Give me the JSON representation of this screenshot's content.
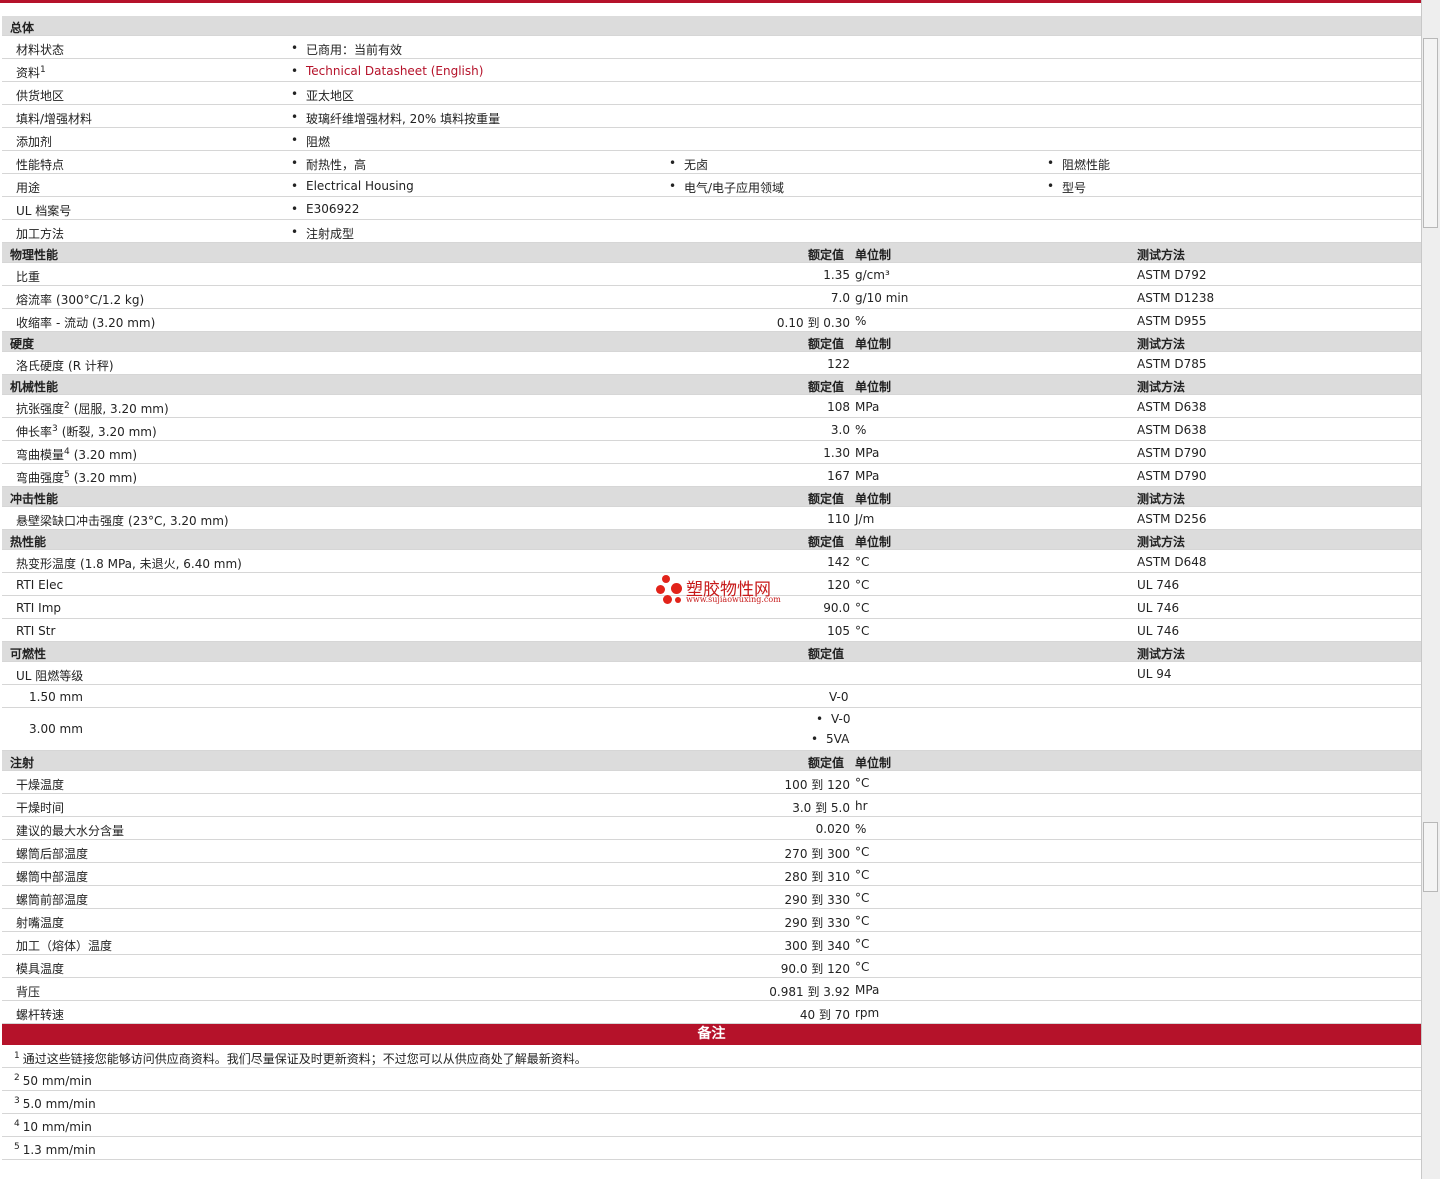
{
  "general": {
    "title": "总体",
    "rows": [
      {
        "label": "材料状态",
        "sup": "",
        "values": [
          "已商用：当前有效"
        ]
      },
      {
        "label": "资料",
        "sup": "1",
        "values": [
          "Technical Datasheet (English)"
        ],
        "link": true
      },
      {
        "label": "供货地区",
        "sup": "",
        "values": [
          "亚太地区"
        ]
      },
      {
        "label": "填料/增强材料",
        "sup": "",
        "values": [
          "玻璃纤维增强材料, 20% 填料按重量"
        ]
      },
      {
        "label": "添加剂",
        "sup": "",
        "values": [
          "阻燃"
        ]
      },
      {
        "label": "性能特点",
        "sup": "",
        "values": [
          "耐热性，高",
          "无卤",
          "阻燃性能"
        ]
      },
      {
        "label": "用途",
        "sup": "",
        "values": [
          "Electrical Housing",
          "电气/电子应用领域",
          "型号"
        ]
      },
      {
        "label": "UL 档案号",
        "sup": "",
        "values": [
          "E306922"
        ]
      },
      {
        "label": "加工方法",
        "sup": "",
        "values": [
          "注射成型"
        ]
      }
    ]
  },
  "headers": {
    "value": "额定值",
    "unit": "单位制",
    "test": "测试方法"
  },
  "sections": [
    {
      "title": "物理性能",
      "unit": true,
      "test": true,
      "rows": [
        {
          "label": "比重",
          "sup": "",
          "extra": "",
          "value": "1.35",
          "unit": "g/cm³",
          "test": "ASTM D792"
        },
        {
          "label": "熔流率",
          "sup": "",
          "extra": "(300°C/1.2 kg)",
          "value": "7.0",
          "unit": "g/10 min",
          "test": "ASTM D1238"
        },
        {
          "label": "收缩率",
          "sup": "",
          "extra": "- 流动 (3.20 mm)",
          "value": "0.10 到  0.30",
          "unit": "%",
          "test": "ASTM D955"
        }
      ]
    },
    {
      "title": "硬度",
      "unit": true,
      "test": true,
      "rows": [
        {
          "label": "洛氏硬度",
          "sup": "",
          "extra": "(R 计秤)",
          "value": "122",
          "unit": "",
          "test": "ASTM D785"
        }
      ]
    },
    {
      "title": "机械性能",
      "unit": true,
      "test": true,
      "rows": [
        {
          "label": "抗张强度",
          "sup": "2",
          "extra": "(屈服, 3.20 mm)",
          "value": "108",
          "unit": "MPa",
          "test": "ASTM D638"
        },
        {
          "label": "伸长率",
          "sup": "3",
          "extra": "(断裂, 3.20 mm)",
          "value": "3.0",
          "unit": "%",
          "test": "ASTM D638"
        },
        {
          "label": "弯曲模量",
          "sup": "4",
          "extra": "(3.20 mm)",
          "value": "1.30",
          "unit": "MPa",
          "test": "ASTM D790"
        },
        {
          "label": "弯曲强度",
          "sup": "5",
          "extra": "(3.20 mm)",
          "value": "167",
          "unit": "MPa",
          "test": "ASTM D790"
        }
      ]
    },
    {
      "title": "冲击性能",
      "unit": true,
      "test": true,
      "rows": [
        {
          "label": "悬壁梁缺口冲击强度",
          "sup": "",
          "extra": "(23°C, 3.20 mm)",
          "value": "110",
          "unit": "J/m",
          "test": "ASTM D256"
        }
      ]
    },
    {
      "title": "热性能",
      "unit": true,
      "test": true,
      "rows": [
        {
          "label": "热变形温度",
          "sup": "",
          "extra": "(1.8 MPa, 未退火, 6.40 mm)",
          "value": "142",
          "unit": "°C",
          "test": "ASTM D648"
        },
        {
          "label": "RTI Elec",
          "sup": "",
          "extra": "",
          "value": "120",
          "unit": "°C",
          "test": "UL 746"
        },
        {
          "label": "RTI Imp",
          "sup": "",
          "extra": "",
          "value": "90.0",
          "unit": "°C",
          "test": "UL 746"
        },
        {
          "label": "RTI Str",
          "sup": "",
          "extra": "",
          "value": "105",
          "unit": "°C",
          "test": "UL 746"
        }
      ]
    }
  ],
  "flammability": {
    "title": "可燃性",
    "label": "UL 阻燃等级",
    "test": "UL 94",
    "sub": [
      {
        "label": "1.50 mm",
        "values": [
          "V-0"
        ]
      },
      {
        "label": "3.00 mm",
        "values": [
          "V-0",
          "5VA"
        ]
      }
    ]
  },
  "injection": {
    "title": "注射",
    "rows": [
      {
        "label": "干燥温度",
        "value": "100 到  120",
        "unit": "°C"
      },
      {
        "label": "干燥时间",
        "value": "3.0 到  5.0",
        "unit": "hr"
      },
      {
        "label": "建议的最大水分含量",
        "value": "0.020",
        "unit": "%"
      },
      {
        "label": "螺筒后部温度",
        "value": "270 到  300",
        "unit": "°C"
      },
      {
        "label": "螺筒中部温度",
        "value": "280 到  310",
        "unit": "°C"
      },
      {
        "label": "螺筒前部温度",
        "value": "290 到  330",
        "unit": "°C"
      },
      {
        "label": "射嘴温度",
        "value": "290 到  330",
        "unit": "°C"
      },
      {
        "label": "加工（熔体）温度",
        "value": "300 到  340",
        "unit": "°C"
      },
      {
        "label": "模具温度",
        "value": "90.0 到  120",
        "unit": "°C"
      },
      {
        "label": "背压",
        "value": "0.981 到  3.92",
        "unit": "MPa"
      },
      {
        "label": "螺杆转速",
        "value": "40 到  70",
        "unit": "rpm"
      }
    ]
  },
  "notes": {
    "title": "备注",
    "items": [
      {
        "num": "1",
        "text": "通过这些链接您能够访问供应商资料。我们尽量保证及时更新资料；不过您可以从供应商处了解最新资料。"
      },
      {
        "num": "2",
        "text": "50 mm/min"
      },
      {
        "num": "3",
        "text": "5.0 mm/min"
      },
      {
        "num": "4",
        "text": "10 mm/min"
      },
      {
        "num": "5",
        "text": "1.3 mm/min"
      }
    ]
  },
  "watermark": {
    "name": "塑胶物性网",
    "url": "www.sujiaowuxing.com"
  },
  "colors": {
    "accent": "#b5122a",
    "section_bg": "#dcdcdc"
  }
}
